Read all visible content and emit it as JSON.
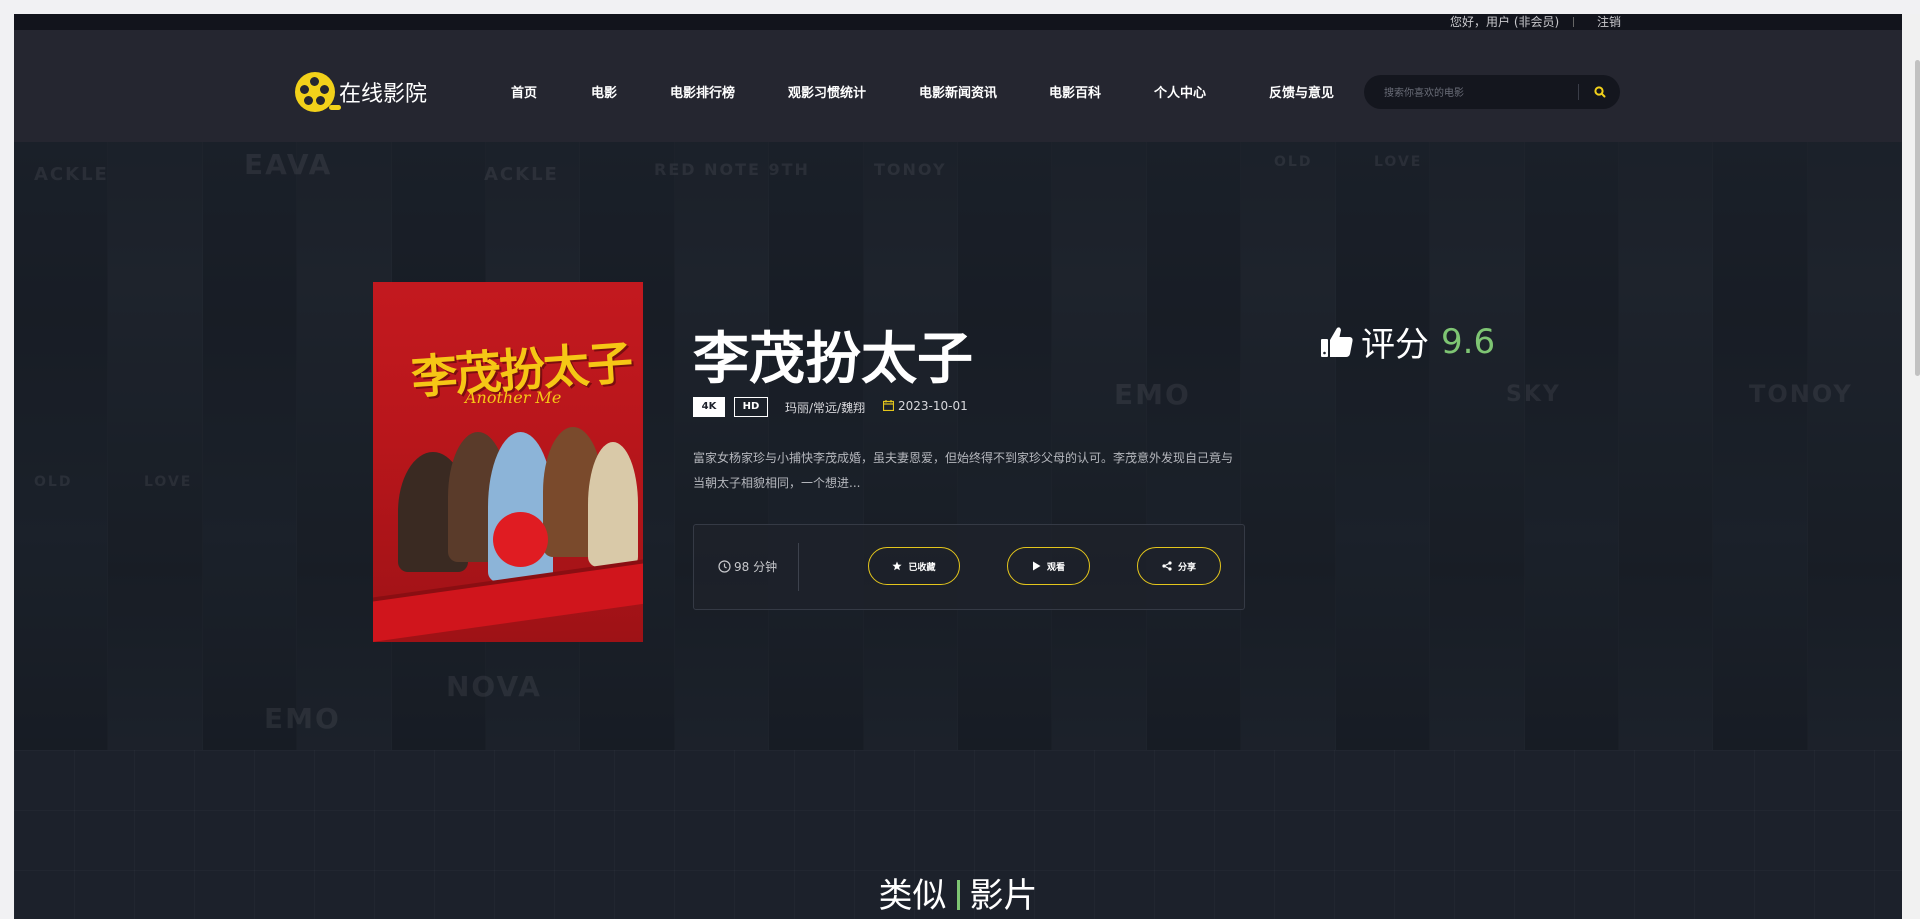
{
  "topbar": {
    "greeting": "您好，用户 (非会员)",
    "logout": "注销"
  },
  "brand": {
    "name": "在线影院",
    "accent": "#f2d11a"
  },
  "nav": {
    "items": [
      {
        "label": "首页"
      },
      {
        "label": "电影"
      },
      {
        "label": "电影排行榜"
      },
      {
        "label": "观影习惯统计"
      },
      {
        "label": "电影新闻资讯"
      },
      {
        "label": "电影百科"
      },
      {
        "label": "个人中心"
      },
      {
        "label": "反馈与意见"
      }
    ]
  },
  "search": {
    "placeholder": "搜索你喜欢的电影",
    "icon": "search-icon"
  },
  "movie": {
    "title": "李茂扮太子",
    "poster_title": "李茂扮太子",
    "poster_subtitle": "Another Me",
    "tags": [
      "4K",
      "HD"
    ],
    "genre": "玛丽/常远/魏翔",
    "date": "2023-10-01",
    "synopsis": "富家女杨家珍与小捕快李茂成婚，虽夫妻恩爱，但始终得不到家珍父母的认可。李茂意外发现自己竟与当朝太子相貌相同，一个想进...",
    "duration": "98 分钟",
    "rating_label": "评分",
    "rating_score": "9.6",
    "rating_color": "#7ec573"
  },
  "actions": {
    "favorite": "已收藏",
    "watch": "观看",
    "share": "分享"
  },
  "hero_ghost_titles": [
    "ACKLE",
    "EAVA",
    "ACKLE",
    "RED NOTE 9TH",
    "TONOY",
    "OLD",
    "LOVE",
    "EMO",
    "SKY",
    "TONOY",
    "NOVA",
    "EMO",
    "OLD",
    "LOVE"
  ],
  "similar": {
    "title_left": "类似",
    "title_right": "影片"
  }
}
